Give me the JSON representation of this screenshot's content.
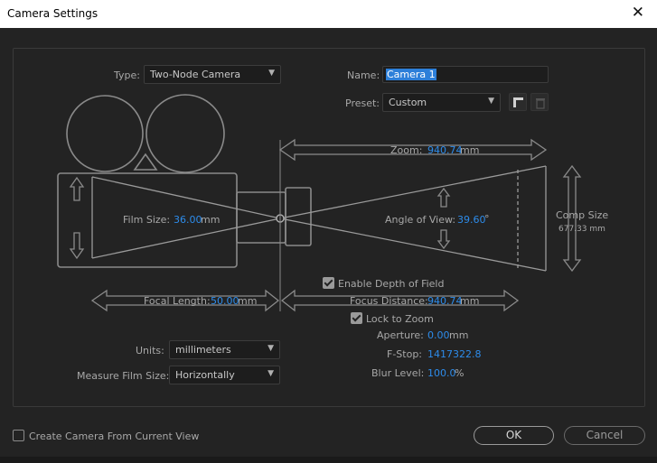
{
  "window": {
    "title": "Camera Settings",
    "close_glyph": "✕"
  },
  "type": {
    "label": "Type:",
    "value": "Two-Node Camera"
  },
  "name": {
    "label": "Name:",
    "value": "Camera 1"
  },
  "preset": {
    "label": "Preset:",
    "value": "Custom"
  },
  "zoom": {
    "label": "Zoom:",
    "value": "940.74",
    "unit": "mm"
  },
  "film_size": {
    "label": "Film Size:",
    "value": "36.00",
    "unit": "mm"
  },
  "angle_of_view": {
    "label": "Angle of View:",
    "value": "39.60",
    "unit": "°"
  },
  "comp_size": {
    "label": "Comp Size",
    "value": "677.33 mm"
  },
  "depth_of_field": {
    "label": "Enable Depth of Field",
    "checked": true
  },
  "focal_length": {
    "label": "Focal Length:",
    "value": "50.00",
    "unit": "mm"
  },
  "focus_distance": {
    "label": "Focus Distance:",
    "value": "940.74",
    "unit": "mm"
  },
  "lock_to_zoom": {
    "label": "Lock to Zoom",
    "checked": true
  },
  "aperture": {
    "label": "Aperture:",
    "value": "0.00",
    "unit": "mm"
  },
  "fstop": {
    "label": "F-Stop:",
    "value": "1417322.8"
  },
  "blur_level": {
    "label": "Blur Level:",
    "value": "100.0",
    "unit": "%"
  },
  "units": {
    "label": "Units:",
    "value": "millimeters"
  },
  "measure_film_size": {
    "label": "Measure Film Size:",
    "value": "Horizontally"
  },
  "create_from_view": {
    "label": "Create Camera From Current View",
    "checked": false
  },
  "buttons": {
    "ok": "OK",
    "cancel": "Cancel"
  },
  "colors": {
    "accent_value": "#2d8ceb",
    "selection": "#2d7fd9",
    "background": "#232323",
    "diagram_line": "#8a8a8a"
  },
  "icons": {
    "preset_save": "save-preset-icon",
    "preset_delete": "trash-icon",
    "dropdown": "chevron-down-icon",
    "close": "close-icon"
  }
}
